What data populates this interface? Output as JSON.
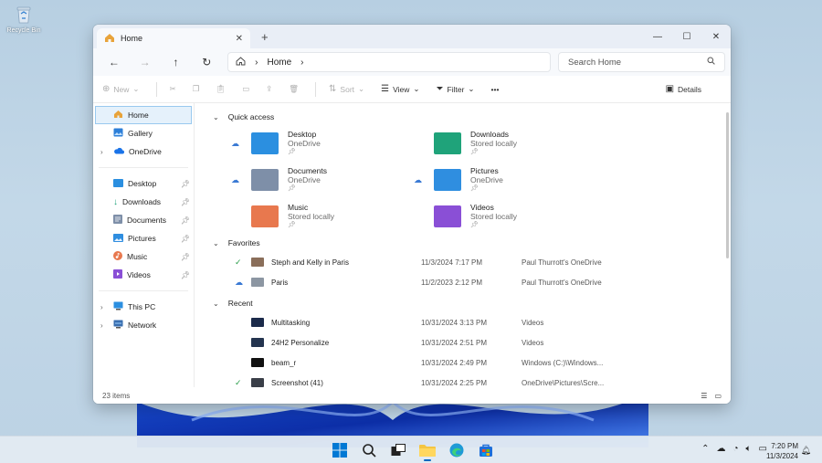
{
  "desktop": {
    "recycle_bin_label": "Recycle Bin"
  },
  "window": {
    "tab_title": "Home",
    "tab_close": "✕",
    "new_tab": "+",
    "controls": {
      "minimize": "—",
      "maximize": "☐",
      "close": "✕"
    }
  },
  "nav": {
    "back": "←",
    "forward": "→",
    "up": "↑",
    "refresh": "↻",
    "breadcrumb": "Home",
    "breadcrumb_chevron": "›",
    "search_placeholder": "Search Home"
  },
  "toolbar": {
    "new_label": "New",
    "sort_label": "Sort",
    "view_label": "View",
    "filter_label": "Filter",
    "more_label": "•••",
    "details_label": "Details"
  },
  "sidebar": {
    "top": [
      {
        "label": "Home"
      },
      {
        "label": "Gallery"
      },
      {
        "label": "OneDrive"
      }
    ],
    "pinned": [
      {
        "label": "Desktop"
      },
      {
        "label": "Downloads"
      },
      {
        "label": "Documents"
      },
      {
        "label": "Pictures"
      },
      {
        "label": "Music"
      },
      {
        "label": "Videos"
      }
    ],
    "bottom": [
      {
        "label": "This PC"
      },
      {
        "label": "Network"
      }
    ]
  },
  "quick_access": {
    "title": "Quick access",
    "items": [
      {
        "name": "Desktop",
        "status": "OneDrive",
        "color": "#2b8fe0"
      },
      {
        "name": "Downloads",
        "status": "Stored locally",
        "color": "#1fa37a"
      },
      {
        "name": "Documents",
        "status": "OneDrive",
        "color": "#7e8fa8"
      },
      {
        "name": "Pictures",
        "status": "OneDrive",
        "color": "#2f8ee0"
      },
      {
        "name": "Music",
        "status": "Stored locally",
        "color": "#e8784e"
      },
      {
        "name": "Videos",
        "status": "Stored locally",
        "color": "#8a4fd6"
      }
    ]
  },
  "favorites": {
    "title": "Favorites",
    "rows": [
      {
        "name": "Steph and Kelly in Paris",
        "date": "11/3/2024 7:17 PM",
        "location": "Paul Thurrott's OneDrive"
      },
      {
        "name": "Paris",
        "date": "11/2/2023 2:12 PM",
        "location": "Paul Thurrott's OneDrive"
      }
    ]
  },
  "recent": {
    "title": "Recent",
    "rows": [
      {
        "name": "Multitasking",
        "date": "10/31/2024 3:13 PM",
        "location": "Videos"
      },
      {
        "name": "24H2 Personalize",
        "date": "10/31/2024 2:51 PM",
        "location": "Videos"
      },
      {
        "name": "beam_r",
        "date": "10/31/2024 2:49 PM",
        "location": "Windows (C:)\\Windows..."
      },
      {
        "name": "Screenshot (41)",
        "date": "10/31/2024 2:25 PM",
        "location": "OneDrive\\Pictures\\Scre..."
      }
    ]
  },
  "status": {
    "items_count": "23 items"
  },
  "taskbar": {
    "time": "7:20 PM",
    "date": "11/3/2024"
  }
}
